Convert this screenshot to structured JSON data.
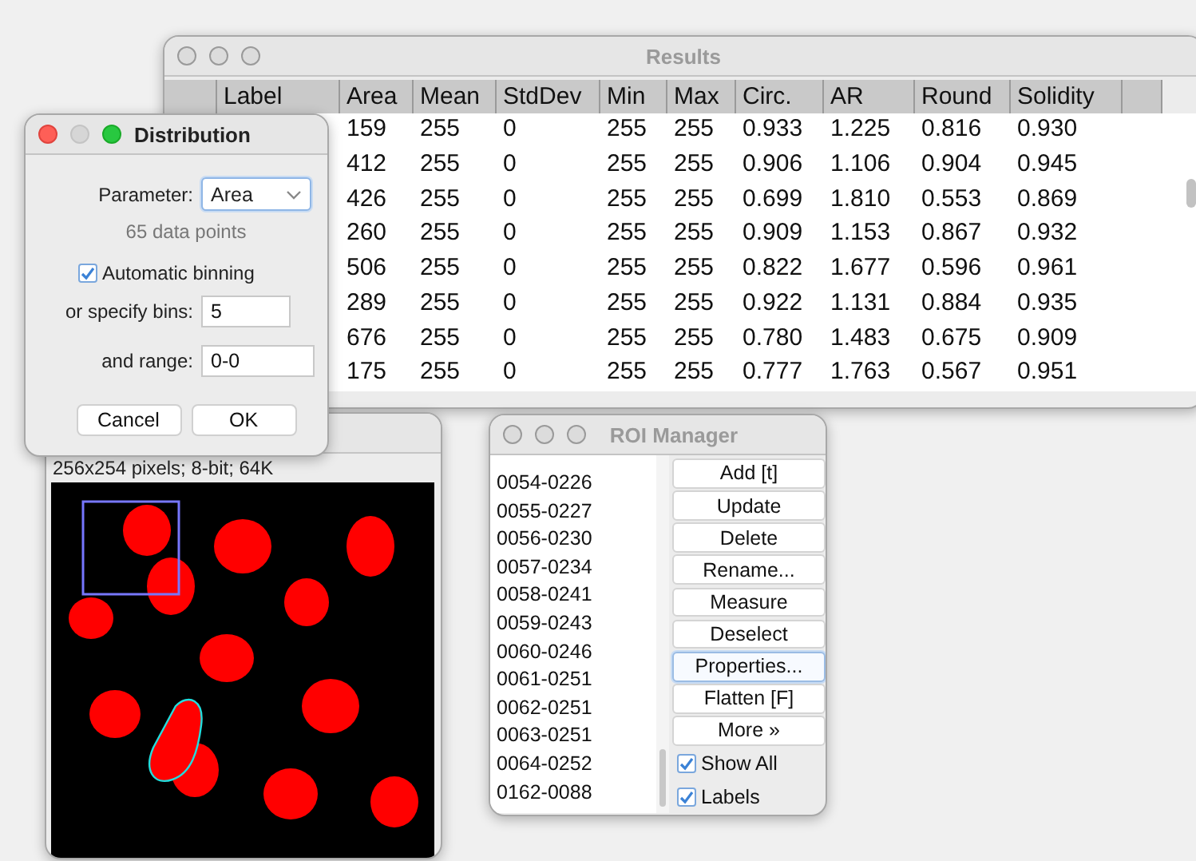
{
  "results_window": {
    "title": "Results",
    "active": false,
    "columns": [
      "Label",
      "Area",
      "Mean",
      "StdDev",
      "Min",
      "Max",
      "Circ.",
      "AR",
      "Round",
      "Solidity"
    ],
    "rows": [
      {
        "cells": [
          "",
          "159",
          "255",
          "0",
          "255",
          "255",
          "0.933",
          "1.225",
          "0.816",
          "0.930"
        ]
      },
      {
        "cells": [
          "",
          "412",
          "255",
          "0",
          "255",
          "255",
          "0.906",
          "1.106",
          "0.904",
          "0.945"
        ]
      },
      {
        "cells": [
          "",
          "426",
          "255",
          "0",
          "255",
          "255",
          "0.699",
          "1.810",
          "0.553",
          "0.869"
        ]
      },
      {
        "cells": [
          "",
          "260",
          "255",
          "0",
          "255",
          "255",
          "0.909",
          "1.153",
          "0.867",
          "0.932"
        ]
      },
      {
        "cells": [
          "",
          "506",
          "255",
          "0",
          "255",
          "255",
          "0.822",
          "1.677",
          "0.596",
          "0.961"
        ]
      },
      {
        "cells": [
          "",
          "289",
          "255",
          "0",
          "255",
          "255",
          "0.922",
          "1.131",
          "0.884",
          "0.935"
        ]
      },
      {
        "cells": [
          "",
          "676",
          "255",
          "0",
          "255",
          "255",
          "0.780",
          "1.483",
          "0.675",
          "0.909"
        ]
      },
      {
        "cells": [
          "",
          "175",
          "255",
          "0",
          "255",
          "255",
          "0.777",
          "1.763",
          "0.567",
          "0.951"
        ]
      }
    ]
  },
  "image_window": {
    "subtitle": "256x254 pixels; 8-bit; 64K"
  },
  "roi_manager": {
    "title": "ROI Manager",
    "active": false,
    "items": [
      "0054-0226",
      "0055-0227",
      "0056-0230",
      "0057-0234",
      "0058-0241",
      "0059-0243",
      "0060-0246",
      "0061-0251",
      "0062-0251",
      "0063-0251",
      "0064-0252",
      "0162-0088"
    ],
    "buttons": [
      {
        "label": "Add [t]",
        "focused": false
      },
      {
        "label": "Update",
        "focused": false
      },
      {
        "label": "Delete",
        "focused": false
      },
      {
        "label": "Rename...",
        "focused": false
      },
      {
        "label": "Measure",
        "focused": false
      },
      {
        "label": "Deselect",
        "focused": false
      },
      {
        "label": "Properties...",
        "focused": true
      },
      {
        "label": "Flatten [F]",
        "focused": false
      },
      {
        "label": "More »",
        "focused": false
      }
    ],
    "checkboxes": [
      {
        "label": "Show All",
        "checked": true
      },
      {
        "label": "Labels",
        "checked": true
      }
    ]
  },
  "distribution_dialog": {
    "title": "Distribution",
    "active": true,
    "parameter_label": "Parameter:",
    "parameter_value": "Area",
    "data_points": "65 data points",
    "automatic_binning": {
      "label": "Automatic binning",
      "checked": true
    },
    "bins_label": "or specify bins:",
    "bins_value": "5",
    "range_label": "and range:",
    "range_value": "0-0",
    "buttons": [
      "Cancel",
      "OK"
    ]
  }
}
